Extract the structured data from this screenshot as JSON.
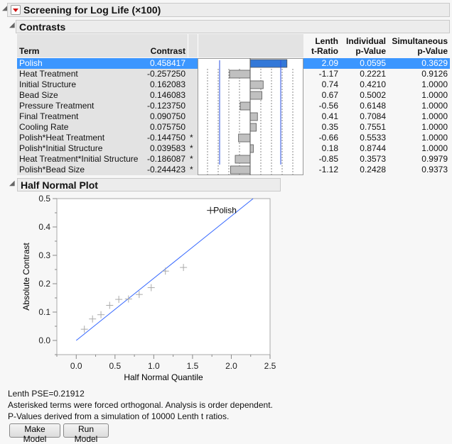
{
  "report": {
    "title": "Screening for Log Life (×100)",
    "contrasts_title": "Contrasts",
    "halfnormal_title": "Half Normal Plot"
  },
  "table": {
    "headers": {
      "term": "Term",
      "contrast": "Contrast",
      "lenth1": "Lenth",
      "lenth2": "t-Ratio",
      "ind1": "Individual",
      "ind2": "p-Value",
      "sim1": "Simultaneous",
      "sim2": "p-Value"
    },
    "selected_row": 0,
    "rows": [
      {
        "term": "Polish",
        "contrast": "0.458417",
        "star": "",
        "t": "2.09",
        "ip": "0.0595",
        "sp": "0.3629",
        "value": 0.458417
      },
      {
        "term": "Heat Treatment",
        "contrast": "-0.257250",
        "star": "",
        "t": "-1.17",
        "ip": "0.2221",
        "sp": "0.9126",
        "value": -0.25725
      },
      {
        "term": "Initial Structure",
        "contrast": "0.162083",
        "star": "",
        "t": "0.74",
        "ip": "0.4210",
        "sp": "1.0000",
        "value": 0.162083
      },
      {
        "term": "Bead Size",
        "contrast": "0.146083",
        "star": "",
        "t": "0.67",
        "ip": "0.5002",
        "sp": "1.0000",
        "value": 0.146083
      },
      {
        "term": "Pressure Treatment",
        "contrast": "-0.123750",
        "star": "",
        "t": "-0.56",
        "ip": "0.6148",
        "sp": "1.0000",
        "value": -0.12375
      },
      {
        "term": "Final Treatment",
        "contrast": "0.090750",
        "star": "",
        "t": "0.41",
        "ip": "0.7084",
        "sp": "1.0000",
        "value": 0.09075
      },
      {
        "term": "Cooling Rate",
        "contrast": "0.075750",
        "star": "",
        "t": "0.35",
        "ip": "0.7551",
        "sp": "1.0000",
        "value": 0.07575
      },
      {
        "term": "Polish*Heat Treatment",
        "contrast": "-0.144750",
        "star": "*",
        "t": "-0.66",
        "ip": "0.5533",
        "sp": "1.0000",
        "value": -0.14475
      },
      {
        "term": "Polish*Initial Structure",
        "contrast": "0.039583",
        "star": "*",
        "t": "0.18",
        "ip": "0.8744",
        "sp": "1.0000",
        "value": 0.039583
      },
      {
        "term": "Heat Treatment*Initial Structure",
        "contrast": "-0.186087",
        "star": "*",
        "t": "-0.85",
        "ip": "0.3573",
        "sp": "0.9979",
        "value": -0.186087
      },
      {
        "term": "Polish*Bead Size",
        "contrast": "-0.244423",
        "star": "*",
        "t": "-1.12",
        "ip": "0.2428",
        "sp": "0.9373",
        "value": -0.244423
      }
    ]
  },
  "chart_data": {
    "type": "scatter",
    "xlabel": "Half Normal Quantile",
    "ylabel": "Absolute Contrast",
    "xlim": [
      -0.25,
      2.5
    ],
    "ylim": [
      -0.05,
      0.5
    ],
    "xticks": [
      "0.0",
      "0.5",
      "1.0",
      "1.5",
      "2.0",
      "2.5"
    ],
    "yticks": [
      "0.0",
      "0.1",
      "0.2",
      "0.3",
      "0.4",
      "0.5"
    ],
    "points": [
      {
        "x": 0.105,
        "y": 0.039583
      },
      {
        "x": 0.21,
        "y": 0.07575
      },
      {
        "x": 0.319,
        "y": 0.09075
      },
      {
        "x": 0.431,
        "y": 0.12375
      },
      {
        "x": 0.549,
        "y": 0.14475
      },
      {
        "x": 0.674,
        "y": 0.146083
      },
      {
        "x": 0.812,
        "y": 0.162083
      },
      {
        "x": 0.967,
        "y": 0.186087
      },
      {
        "x": 1.15,
        "y": 0.244423
      },
      {
        "x": 1.383,
        "y": 0.25725
      },
      {
        "x": 1.732,
        "y": 0.458417,
        "label": "Polish"
      }
    ],
    "reference_line_slope": 0.21912,
    "line_color": "#3366ff",
    "grid": false
  },
  "notes": {
    "pse": "Lenth PSE=0.21912",
    "asterisk": "Asterisked terms were forced orthogonal. Analysis is order dependent.",
    "pvalues": "P-Values derived from a simulation of 10000 Lenth t ratios."
  },
  "buttons": {
    "make_model": "Make Model",
    "run_model": "Run Model"
  },
  "colors": {
    "selection": "#3b96ff",
    "menu_arrow": "#d01010"
  }
}
